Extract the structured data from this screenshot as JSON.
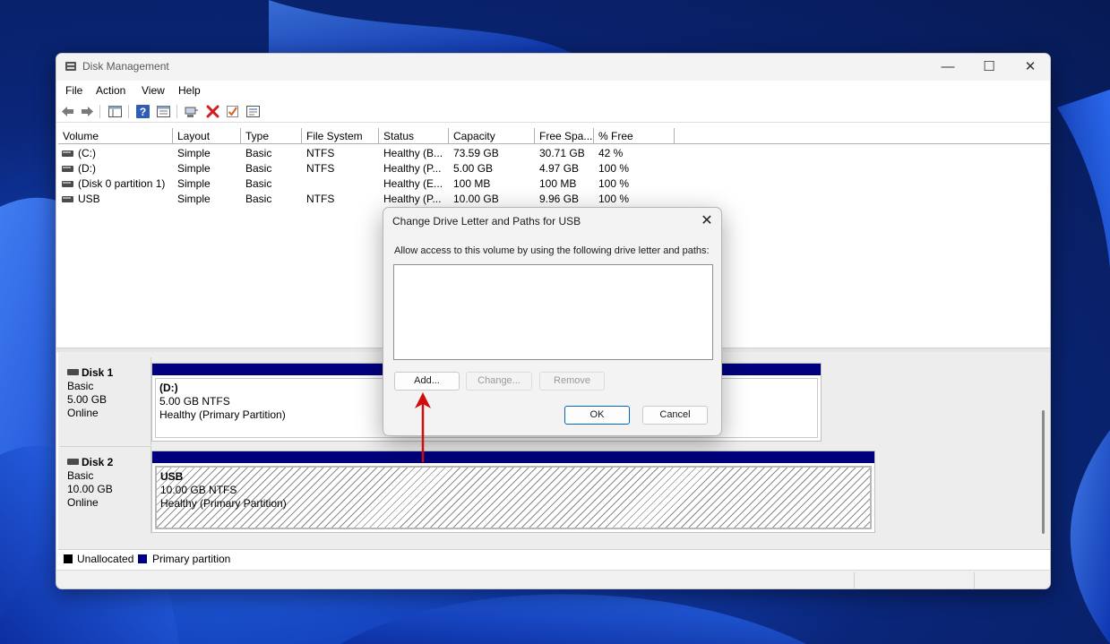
{
  "window": {
    "title": "Disk Management",
    "controls": {
      "minimize": "—",
      "maximize": "☐",
      "close": "✕"
    }
  },
  "menu": [
    "File",
    "Action",
    "View",
    "Help"
  ],
  "toolbar": [
    "back-arrow-icon",
    "forward-arrow-icon",
    "console-tree-icon",
    "help-icon",
    "properties-icon",
    "connect-icon",
    "delete-icon",
    "check-icon",
    "settings-icon"
  ],
  "volume_list": {
    "columns": [
      "Volume",
      "Layout",
      "Type",
      "File System",
      "Status",
      "Capacity",
      "Free Spa...",
      "% Free"
    ],
    "rows": [
      [
        "(C:)",
        "Simple",
        "Basic",
        "NTFS",
        "Healthy (B...",
        "73.59 GB",
        "30.71 GB",
        "42 %"
      ],
      [
        "(D:)",
        "Simple",
        "Basic",
        "NTFS",
        "Healthy (P...",
        "5.00 GB",
        "4.97 GB",
        "100 %"
      ],
      [
        "(Disk 0 partition 1)",
        "Simple",
        "Basic",
        "",
        "Healthy (E...",
        "100 MB",
        "100 MB",
        "100 %"
      ],
      [
        "USB",
        "Simple",
        "Basic",
        "NTFS",
        "Healthy (P...",
        "10.00 GB",
        "9.96 GB",
        "100 %"
      ]
    ]
  },
  "disks": [
    {
      "name": "Disk 1",
      "type": "Basic",
      "size": "5.00 GB",
      "state": "Online",
      "partition": {
        "name": "(D:)",
        "size": "5.00 GB NTFS",
        "status": "Healthy (Primary Partition)"
      }
    },
    {
      "name": "Disk 2",
      "type": "Basic",
      "size": "10.00 GB",
      "state": "Online",
      "partition": {
        "name": "USB",
        "size": "10.00 GB NTFS",
        "status": "Healthy (Primary Partition)"
      }
    }
  ],
  "legend": [
    {
      "label": "Unallocated",
      "color": "#000000"
    },
    {
      "label": "Primary partition",
      "color": "#00007f"
    }
  ],
  "dialog": {
    "title": "Change Drive Letter and Paths for USB",
    "description": "Allow access to this volume by using the following drive letter and paths:",
    "paths": [],
    "buttons": {
      "add": "Add...",
      "change": "Change...",
      "remove": "Remove",
      "ok": "OK",
      "cancel": "Cancel"
    },
    "close": "✕"
  },
  "colors": {
    "partition_bar": "#00007f",
    "arrow": "#d10c0c",
    "accent": "#0067c0"
  }
}
